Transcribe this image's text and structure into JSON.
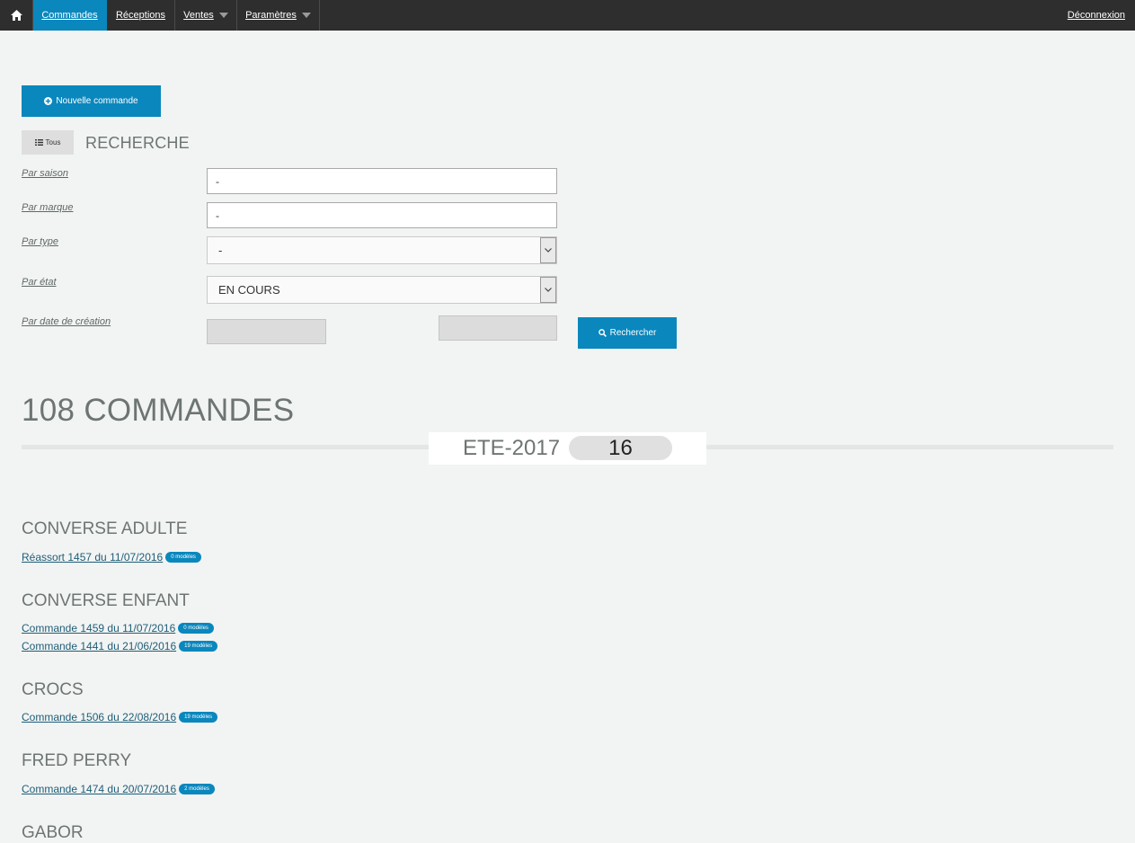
{
  "nav": {
    "home_icon": "home-icon",
    "items": [
      {
        "label": "Commandes",
        "active": true,
        "has_caret": false
      },
      {
        "label": "Réceptions",
        "active": false,
        "has_caret": false
      },
      {
        "label": "Ventes",
        "active": false,
        "has_caret": true
      },
      {
        "label": "Paramètres",
        "active": false,
        "has_caret": true
      }
    ],
    "logout_label": "Déconnexion"
  },
  "new_order_button": "Nouvelle commande",
  "filter_all_button": "Tous",
  "search": {
    "heading": "RECHERCHE",
    "season_label": "Par saison",
    "season_value": "-",
    "brand_label": "Par marque",
    "brand_value": "-",
    "type_label": "Par type",
    "type_value": "-",
    "state_label": "Par état",
    "state_value": "EN COURS",
    "date_label": "Par date de création",
    "search_button": "Rechercher"
  },
  "results": {
    "count_heading": "108 COMMANDES",
    "season_name": "ETE-2017",
    "season_count": "16",
    "groups": [
      {
        "brand": "CONVERSE ADULTE",
        "orders": [
          {
            "label": "Réassort 1457 du 11/07/2016",
            "badge": "0 modèles"
          }
        ]
      },
      {
        "brand": "CONVERSE ENFANT",
        "orders": [
          {
            "label": "Commande 1459 du 11/07/2016",
            "badge": "0 modèles"
          },
          {
            "label": "Commande 1441 du 21/06/2016",
            "badge": "19 modèles"
          }
        ]
      },
      {
        "brand": "CROCS",
        "orders": [
          {
            "label": "Commande 1506 du 22/08/2016",
            "badge": "19 modèles"
          }
        ]
      },
      {
        "brand": "FRED PERRY",
        "orders": [
          {
            "label": "Commande 1474 du 20/07/2016",
            "badge": "2 modèles"
          }
        ]
      },
      {
        "brand": "GABOR",
        "orders": []
      }
    ]
  },
  "colors": {
    "navbar": "#2e2e2e",
    "accent": "#0a87bd",
    "background": "#f2f4f3",
    "link": "#1e5d78"
  }
}
